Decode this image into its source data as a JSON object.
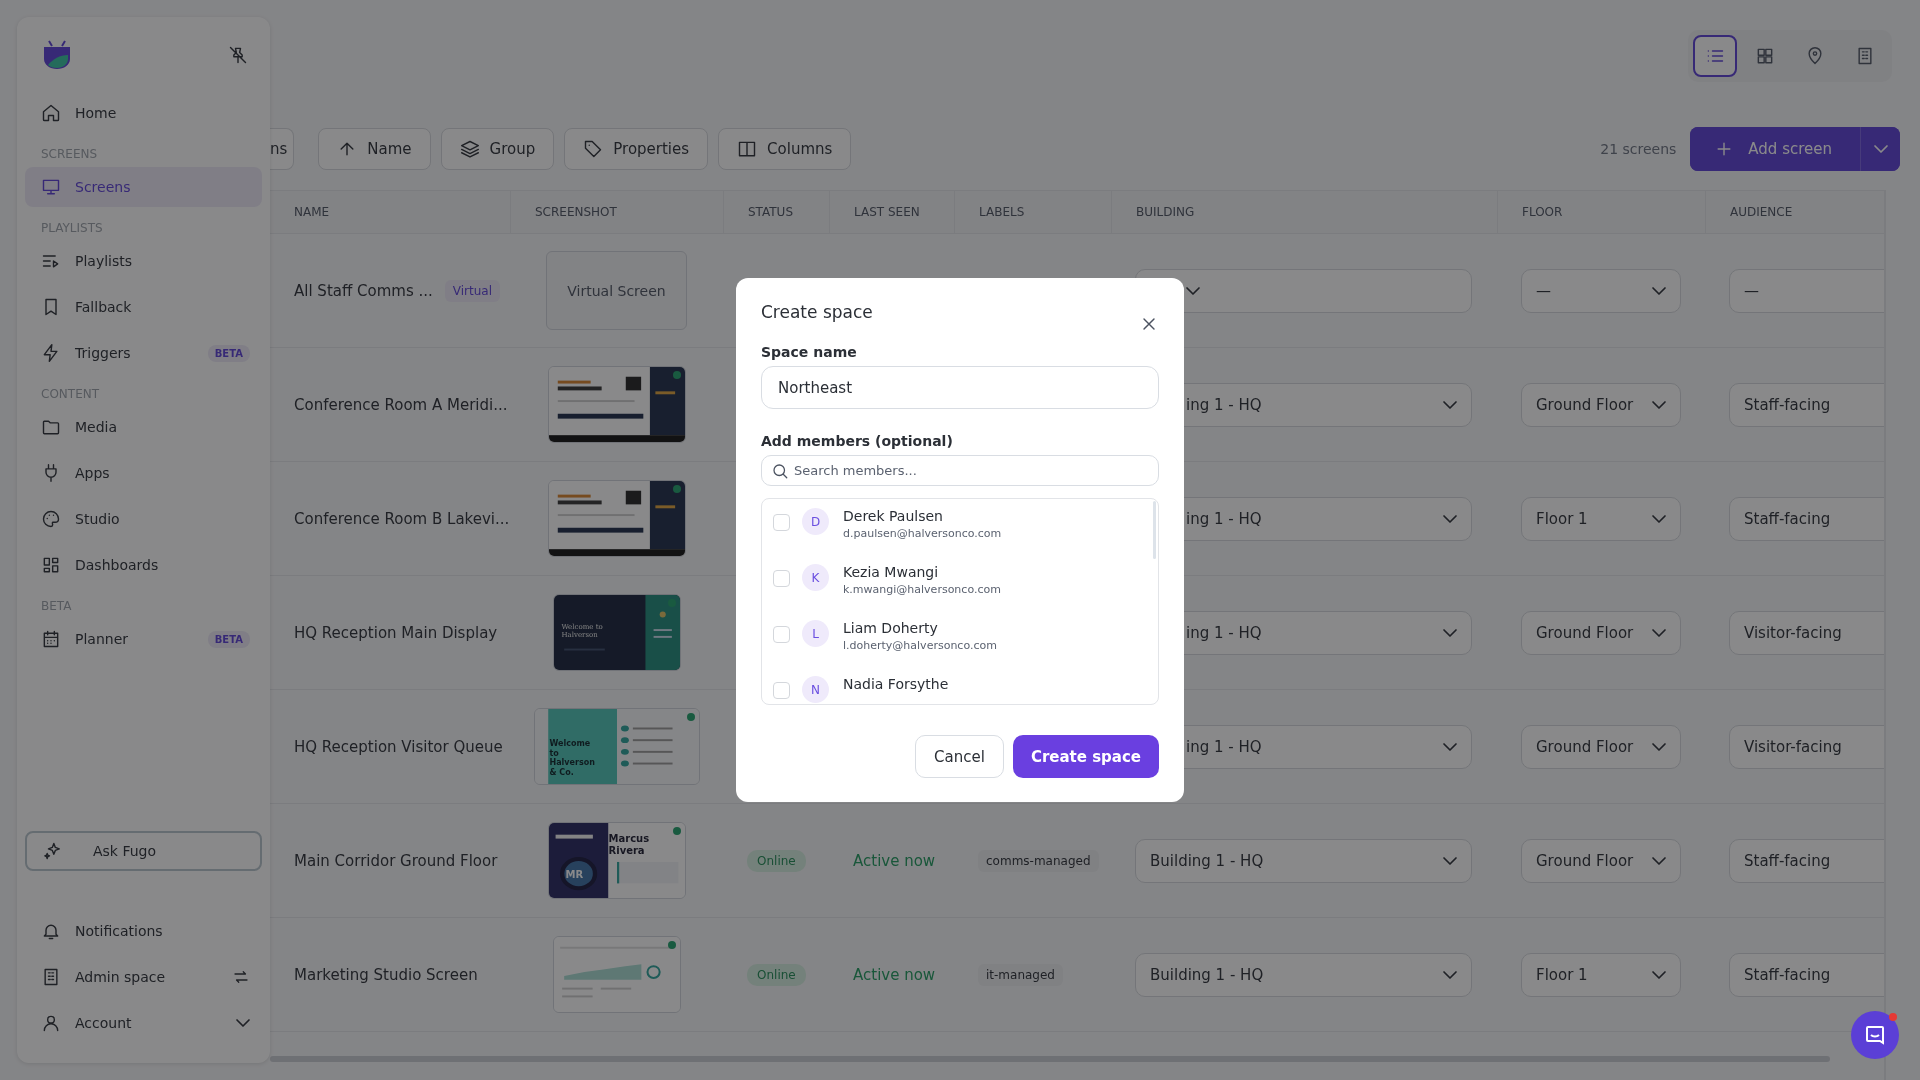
{
  "sidebar": {
    "nav": [
      {
        "kind": "item",
        "label": "Home",
        "selected": false
      },
      {
        "kind": "section",
        "label": "SCREENS"
      },
      {
        "kind": "item",
        "label": "Screens",
        "selected": true
      },
      {
        "kind": "section",
        "label": "PLAYLISTS"
      },
      {
        "kind": "item",
        "label": "Playlists",
        "selected": false
      },
      {
        "kind": "item",
        "label": "Fallback",
        "selected": false
      },
      {
        "kind": "item",
        "label": "Triggers",
        "selected": false,
        "badge": "BETA"
      },
      {
        "kind": "section",
        "label": "CONTENT"
      },
      {
        "kind": "item",
        "label": "Media",
        "selected": false
      },
      {
        "kind": "item",
        "label": "Apps",
        "selected": false
      },
      {
        "kind": "item",
        "label": "Studio",
        "selected": false
      },
      {
        "kind": "item",
        "label": "Dashboards",
        "selected": false
      },
      {
        "kind": "section",
        "label": "BETA"
      },
      {
        "kind": "item",
        "label": "Planner",
        "selected": false,
        "badge": "BETA"
      }
    ],
    "assistant_button": "Ask Fugo",
    "bottom": [
      {
        "label": "Notifications"
      },
      {
        "label": "Admin space"
      },
      {
        "label": "Account"
      }
    ]
  },
  "view_switcher": [
    {
      "selected": true
    },
    {
      "selected": false
    },
    {
      "selected": false
    },
    {
      "selected": false
    }
  ],
  "toolbar": {
    "buttons": [
      "ns",
      "Name",
      "Group",
      "Properties",
      "Columns"
    ],
    "count": "21 screens",
    "primary": "Add screen"
  },
  "table": {
    "columns": [
      "NAME",
      "SCREENSHOT",
      "STATUS",
      "LAST SEEN",
      "LABELS",
      "BUILDING",
      "FLOOR",
      "AUDIENCE"
    ],
    "rows": [
      {
        "name": "All Staff Comms ...",
        "badge": "Virtual",
        "screenshot": {
          "kind": "virtual",
          "text": "Virtual Screen",
          "live": false
        },
        "floor": "—",
        "audience": "—"
      },
      {
        "name": "Conference Room A Meridi...",
        "screenshot": {
          "kind": "menu",
          "live": true
        },
        "building": "ing 1 - HQ",
        "floor": "Ground Floor",
        "audience": "Staff-facing"
      },
      {
        "name": "Conference Room B Lakevi...",
        "screenshot": {
          "kind": "menu",
          "live": true
        },
        "building": "ing 1 - HQ",
        "floor": "Floor 1",
        "audience": "Staff-facing"
      },
      {
        "name": "HQ Reception Main Display",
        "screenshot": {
          "kind": "welcome-dark",
          "text": "Welcome to Halverson",
          "live": true
        },
        "building": "ing 1 - HQ",
        "floor": "Ground Floor",
        "audience": "Visitor-facing"
      },
      {
        "name": "HQ Reception Visitor Queue",
        "screenshot": {
          "kind": "welcome-teal",
          "text": "Welcome to Halverson & Co.",
          "live": true
        },
        "building": "ing 1 - HQ",
        "floor": "Ground Floor",
        "audience": "Visitor-facing"
      },
      {
        "name": "Main Corridor Ground Floor",
        "screenshot": {
          "kind": "employee",
          "text": "Marcus Rivera",
          "initials": "MR",
          "live": true
        },
        "status": "Online",
        "last_seen": "Active now",
        "labels": [
          "comms-managed"
        ],
        "building": "Building 1 - HQ",
        "floor": "Ground Floor",
        "audience": "Staff-facing"
      },
      {
        "name": "Marketing Studio Screen",
        "screenshot": {
          "kind": "dashboard",
          "live": true
        },
        "status": "Online",
        "last_seen": "Active now",
        "labels": [
          "it-managed"
        ],
        "building": "Building 1 - HQ",
        "floor": "Floor 1",
        "audience": "Staff-facing"
      }
    ]
  },
  "modal": {
    "title": "Create space",
    "name_label": "Space name",
    "name_value": "Northeast",
    "members_label": "Add members (optional)",
    "search_placeholder": "Search members...",
    "members": [
      {
        "initial": "D",
        "name": "Derek Paulsen",
        "email": "d.paulsen@halversonco.com",
        "checked": false
      },
      {
        "initial": "K",
        "name": "Kezia Mwangi",
        "email": "k.mwangi@halversonco.com",
        "checked": false
      },
      {
        "initial": "L",
        "name": "Liam Doherty",
        "email": "l.doherty@halversonco.com",
        "checked": false
      },
      {
        "initial": "N",
        "name": "Nadia Forsythe",
        "checked": false
      }
    ],
    "cancel": "Cancel",
    "submit": "Create space"
  },
  "chat": {
    "unread": true
  }
}
